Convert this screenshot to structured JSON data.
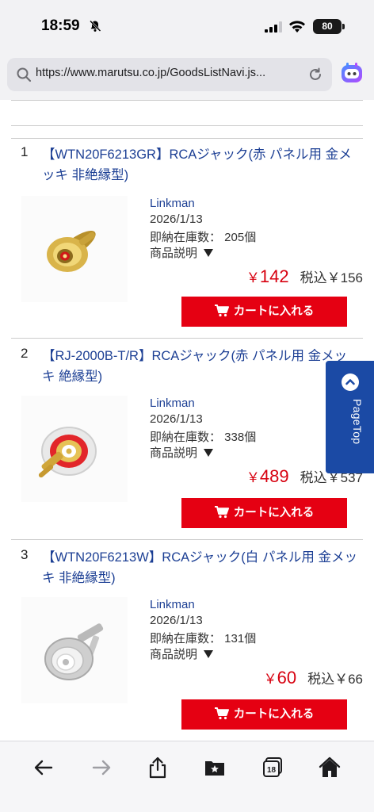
{
  "status_bar": {
    "time": "18:59",
    "battery": "80"
  },
  "address_bar": {
    "url": "https://www.marutsu.co.jp/GoodsListNavi.js..."
  },
  "products": [
    {
      "index": "1",
      "title": "【WTN20F6213GR】RCAジャック(赤 パネル用 金メッキ 非絶縁型)",
      "brand": "Linkman",
      "date": "2026/1/13",
      "stock": "即納在庫数： 205個",
      "desc_label": "商品説明",
      "price_symbol": "￥",
      "price": "142",
      "tax_price": "税込￥156",
      "cart_label": "カートに入れる",
      "ring_color": "#d01818"
    },
    {
      "index": "2",
      "title": "【RJ-2000B-T/R】RCAジャック(赤 パネル用 金メッキ 絶縁型)",
      "brand": "Linkman",
      "date": "2026/1/13",
      "stock": "即納在庫数： 338個",
      "desc_label": "商品説明",
      "price_symbol": "￥",
      "price": "489",
      "tax_price": "税込￥537",
      "cart_label": "カートに入れる",
      "ring_color": "#d01818"
    },
    {
      "index": "3",
      "title": "【WTN20F6213W】RCAジャック(白 パネル用 金メッキ 非絶縁型)",
      "brand": "Linkman",
      "date": "2026/1/13",
      "stock": "即納在庫数： 131個",
      "desc_label": "商品説明",
      "price_symbol": "￥",
      "price": "60",
      "tax_price": "税込￥66",
      "cart_label": "カートに入れる",
      "ring_color": "#ffffff"
    }
  ],
  "pagetop": {
    "label": "PageTop"
  },
  "toolbar": {
    "tabs_count": "18",
    "icons": [
      "back-icon",
      "forward-icon",
      "share-icon",
      "bookmarks-icon",
      "tabs-icon",
      "home-icon"
    ]
  },
  "colors": {
    "link_blue": "#1c3f94",
    "price_red": "#d7000f",
    "cart_red": "#e50012",
    "pagetop_blue": "#1b4aa5"
  }
}
